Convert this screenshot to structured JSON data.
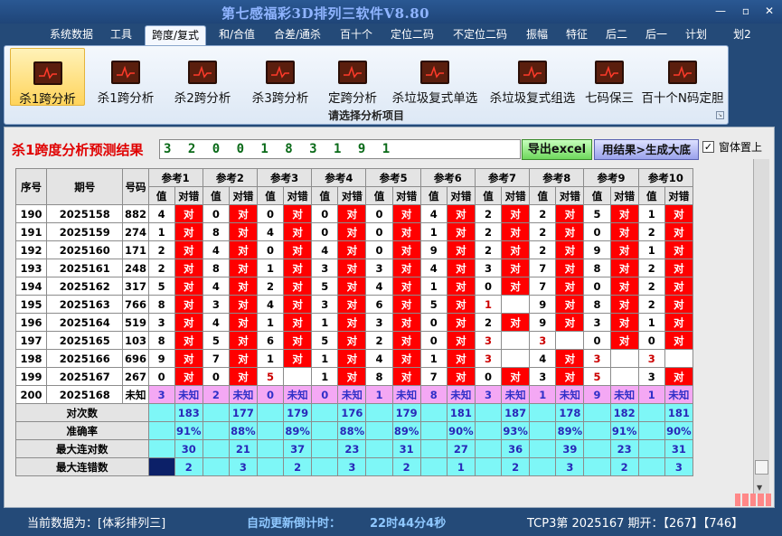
{
  "app": {
    "title": "第七感福彩3D排列三软件V8.80"
  },
  "window": {
    "minimize": "—",
    "restore": "▫",
    "close": "✕"
  },
  "menu": [
    "系统数据",
    "工具",
    "跨度/复式",
    "和/合值",
    "合差/通杀",
    "百十个",
    "定位二码",
    "不定位二码",
    "振幅",
    "特征",
    "后二",
    "后一",
    "计划",
    "划2"
  ],
  "ribbon": {
    "buttons": [
      "杀1跨分析",
      "杀1跨分析",
      "杀2跨分析",
      "杀3跨分析",
      "定跨分析",
      "杀垃圾复式单选",
      "杀垃圾复式组选",
      "七码保三",
      "百十个N码定胆"
    ],
    "group_label": "请选择分析项目",
    "icon": "chart-icon",
    "selected_index": 0
  },
  "panel": {
    "caption": "杀1跨度分析预测结果",
    "result": "3 2 0 0 1 8 3 1 9 1",
    "export_button": "导出excel",
    "generate_button": "用结果>生成大底",
    "checkbox_label": "窗体置上",
    "checkbox_checked": true,
    "checkbox_mark": "✓"
  },
  "table": {
    "headers": {
      "seq": "序号",
      "issue": "期号",
      "number": "号码",
      "value": "值",
      "check": "对错"
    },
    "refs": [
      "参考1",
      "参考2",
      "参考3",
      "参考4",
      "参考5",
      "参考6",
      "参考7",
      "参考8",
      "参考9",
      "参考10"
    ],
    "colors": {
      "hit": "#ff0000",
      "miss": "#ffffff",
      "pending": "#f4a8f4",
      "stats": "#7ef7f7"
    },
    "rows": [
      {
        "seq": "190",
        "issue": "2025158",
        "number": "882",
        "refs": [
          [
            "4",
            "对"
          ],
          [
            "0",
            "对"
          ],
          [
            "0",
            "对"
          ],
          [
            "0",
            "对"
          ],
          [
            "0",
            "对"
          ],
          [
            "4",
            "对"
          ],
          [
            "2",
            "对"
          ],
          [
            "2",
            "对"
          ],
          [
            "5",
            "对"
          ],
          [
            "1",
            "对"
          ]
        ]
      },
      {
        "seq": "191",
        "issue": "2025159",
        "number": "274",
        "refs": [
          [
            "1",
            "对"
          ],
          [
            "8",
            "对"
          ],
          [
            "4",
            "对"
          ],
          [
            "0",
            "对"
          ],
          [
            "0",
            "对"
          ],
          [
            "1",
            "对"
          ],
          [
            "2",
            "对"
          ],
          [
            "2",
            "对"
          ],
          [
            "0",
            "对"
          ],
          [
            "2",
            "对"
          ]
        ]
      },
      {
        "seq": "192",
        "issue": "2025160",
        "number": "171",
        "refs": [
          [
            "2",
            "对"
          ],
          [
            "4",
            "对"
          ],
          [
            "0",
            "对"
          ],
          [
            "4",
            "对"
          ],
          [
            "0",
            "对"
          ],
          [
            "9",
            "对"
          ],
          [
            "2",
            "对"
          ],
          [
            "2",
            "对"
          ],
          [
            "9",
            "对"
          ],
          [
            "1",
            "对"
          ]
        ]
      },
      {
        "seq": "193",
        "issue": "2025161",
        "number": "248",
        "refs": [
          [
            "2",
            "对"
          ],
          [
            "8",
            "对"
          ],
          [
            "1",
            "对"
          ],
          [
            "3",
            "对"
          ],
          [
            "3",
            "对"
          ],
          [
            "4",
            "对"
          ],
          [
            "3",
            "对"
          ],
          [
            "7",
            "对"
          ],
          [
            "8",
            "对"
          ],
          [
            "2",
            "对"
          ]
        ]
      },
      {
        "seq": "194",
        "issue": "2025162",
        "number": "317",
        "refs": [
          [
            "5",
            "对"
          ],
          [
            "4",
            "对"
          ],
          [
            "2",
            "对"
          ],
          [
            "5",
            "对"
          ],
          [
            "4",
            "对"
          ],
          [
            "1",
            "对"
          ],
          [
            "0",
            "对"
          ],
          [
            "7",
            "对"
          ],
          [
            "0",
            "对"
          ],
          [
            "2",
            "对"
          ]
        ]
      },
      {
        "seq": "195",
        "issue": "2025163",
        "number": "766",
        "refs": [
          [
            "8",
            "对"
          ],
          [
            "3",
            "对"
          ],
          [
            "4",
            "对"
          ],
          [
            "3",
            "对"
          ],
          [
            "6",
            "对"
          ],
          [
            "5",
            "对"
          ],
          [
            "1",
            ""
          ],
          [
            "9",
            "对"
          ],
          [
            "8",
            "对"
          ],
          [
            "2",
            "对"
          ]
        ]
      },
      {
        "seq": "196",
        "issue": "2025164",
        "number": "519",
        "refs": [
          [
            "3",
            "对"
          ],
          [
            "4",
            "对"
          ],
          [
            "1",
            "对"
          ],
          [
            "1",
            "对"
          ],
          [
            "3",
            "对"
          ],
          [
            "0",
            "对"
          ],
          [
            "2",
            "对"
          ],
          [
            "9",
            "对"
          ],
          [
            "3",
            "对"
          ],
          [
            "1",
            "对"
          ]
        ]
      },
      {
        "seq": "197",
        "issue": "2025165",
        "number": "103",
        "refs": [
          [
            "8",
            "对"
          ],
          [
            "5",
            "对"
          ],
          [
            "6",
            "对"
          ],
          [
            "5",
            "对"
          ],
          [
            "2",
            "对"
          ],
          [
            "0",
            "对"
          ],
          [
            "3",
            ""
          ],
          [
            "3",
            ""
          ],
          [
            "0",
            "对"
          ],
          [
            "0",
            "对"
          ]
        ]
      },
      {
        "seq": "198",
        "issue": "2025166",
        "number": "696",
        "refs": [
          [
            "9",
            "对"
          ],
          [
            "7",
            "对"
          ],
          [
            "1",
            "对"
          ],
          [
            "1",
            "对"
          ],
          [
            "4",
            "对"
          ],
          [
            "1",
            "对"
          ],
          [
            "3",
            ""
          ],
          [
            "4",
            "对"
          ],
          [
            "3",
            ""
          ],
          [
            "3",
            ""
          ]
        ]
      },
      {
        "seq": "199",
        "issue": "2025167",
        "number": "267",
        "refs": [
          [
            "0",
            "对"
          ],
          [
            "0",
            "对"
          ],
          [
            "5",
            ""
          ],
          [
            "1",
            "对"
          ],
          [
            "8",
            "对"
          ],
          [
            "7",
            "对"
          ],
          [
            "0",
            "对"
          ],
          [
            "3",
            "对"
          ],
          [
            "5",
            ""
          ],
          [
            "3",
            "对"
          ]
        ]
      },
      {
        "seq": "200",
        "issue": "2025168",
        "number": "未知",
        "refs": [
          [
            "3",
            "未知"
          ],
          [
            "2",
            "未知"
          ],
          [
            "0",
            "未知"
          ],
          [
            "0",
            "未知"
          ],
          [
            "1",
            "未知"
          ],
          [
            "8",
            "未知"
          ],
          [
            "3",
            "未知"
          ],
          [
            "1",
            "未知"
          ],
          [
            "9",
            "未知"
          ],
          [
            "1",
            "未知"
          ]
        ]
      }
    ],
    "stats": [
      {
        "label": "对次数",
        "values": [
          "183",
          "177",
          "179",
          "176",
          "179",
          "181",
          "187",
          "178",
          "182",
          "181"
        ]
      },
      {
        "label": "准确率",
        "values": [
          "91%",
          "88%",
          "89%",
          "88%",
          "89%",
          "90%",
          "93%",
          "89%",
          "91%",
          "90%"
        ]
      },
      {
        "label": "最大连对数",
        "values": [
          "30",
          "21",
          "37",
          "23",
          "31",
          "27",
          "36",
          "39",
          "23",
          "31"
        ]
      },
      {
        "label": "最大连错数",
        "values": [
          "2",
          "3",
          "2",
          "3",
          "2",
          "1",
          "2",
          "3",
          "2",
          "3"
        ]
      }
    ]
  },
  "status": {
    "current_data": "当前数据为：[体彩排列三]",
    "countdown_label": "自动更新倒计时：",
    "countdown": "22时44分4秒",
    "draw_info": "TCP3第 2025167 期开：【267】【746】"
  }
}
